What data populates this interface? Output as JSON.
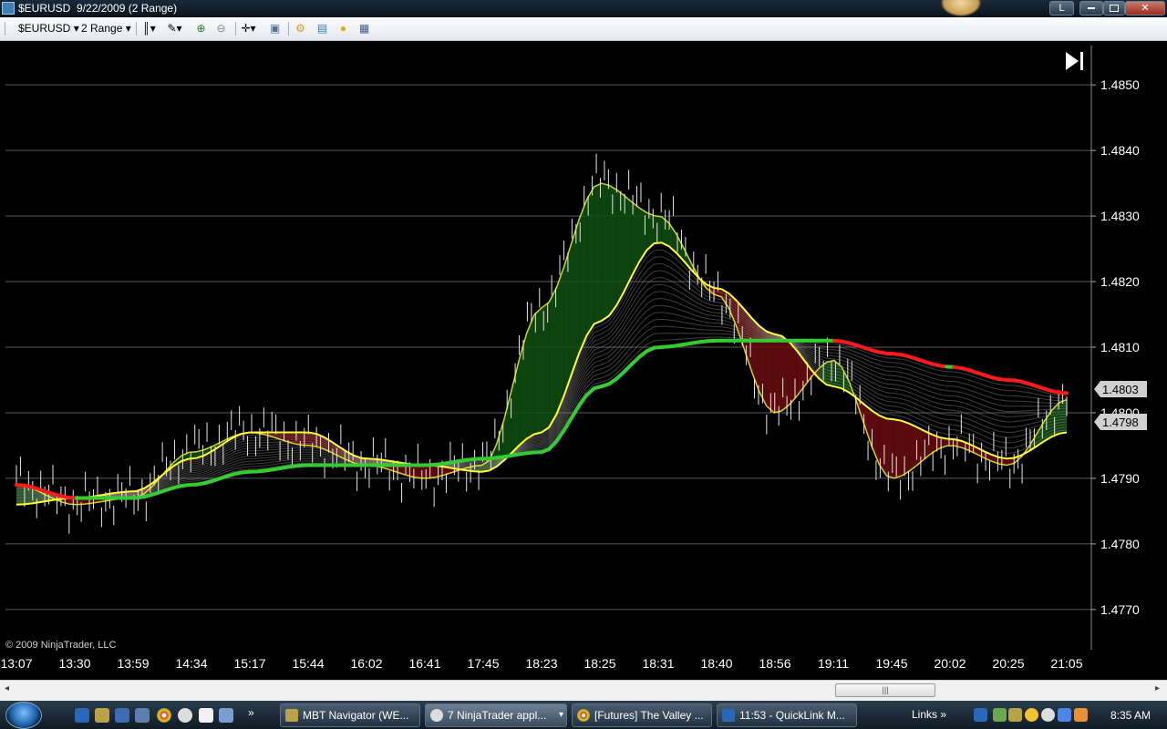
{
  "window": {
    "title": "$EURUSD  9/22/2009 (2 Range)",
    "buttons": [
      "L",
      "",
      "",
      "✕"
    ]
  },
  "toolbar": {
    "instrument": "$EURUSD",
    "period": "2 Range",
    "icons": [
      "bar-type-icon",
      "drawing-tools-icon",
      "zoom-in-icon",
      "zoom-out-icon",
      "crosshair-icon",
      "data-box-icon",
      "strategies-icon",
      "indicators-icon",
      "properties-icon",
      "chart-trader-icon"
    ]
  },
  "chart": {
    "copyright": "© 2009 NinjaTrader, LLC",
    "price_labels": [
      "1.4850",
      "1.4840",
      "1.4830",
      "1.4820",
      "1.4810",
      "1.4800",
      "1.4790",
      "1.4780",
      "1.4770"
    ],
    "last_price_red": "1.4803",
    "last_price_yellow": "1.4798",
    "time_labels": [
      "13:07",
      "13:30",
      "13:59",
      "14:34",
      "15:17",
      "15:44",
      "16:02",
      "16:41",
      "17:45",
      "18:23",
      "18:25",
      "18:31",
      "18:40",
      "18:56",
      "19:11",
      "19:45",
      "20:02",
      "20:25",
      "21:05"
    ],
    "colors": {
      "bg": "#000000",
      "fast": "#ffff33",
      "slow": "#33cc33",
      "bear": "#ff1a1a",
      "bull_fill": "#0f4f0f",
      "bear_fill": "#6b0d0d",
      "grid": "#5a5a5a"
    }
  },
  "chart_data": {
    "type": "line",
    "title": "",
    "x": [
      "13:07",
      "13:30",
      "13:59",
      "14:34",
      "15:17",
      "15:44",
      "16:02",
      "16:41",
      "17:45",
      "18:23",
      "18:25",
      "18:31",
      "18:40",
      "18:56",
      "19:11",
      "19:45",
      "20:02",
      "20:25",
      "21:05"
    ],
    "ylim": [
      1.4764,
      1.4856
    ],
    "grid": true,
    "series": [
      {
        "values": [
          1.4789,
          1.4786,
          1.4787,
          1.4794,
          1.4797,
          1.4795,
          1.4792,
          1.479,
          1.4792,
          1.4816,
          1.4835,
          1.483,
          1.4818,
          1.48,
          1.4808,
          1.479,
          1.4795,
          1.4792,
          1.4802
        ]
      },
      {
        "values": [
          1.4786,
          1.4787,
          1.4788,
          1.4793,
          1.4797,
          1.4797,
          1.4793,
          1.4792,
          1.4791,
          1.4797,
          1.4814,
          1.4826,
          1.4819,
          1.4812,
          1.4804,
          1.4799,
          1.4796,
          1.4793,
          1.4797
        ]
      },
      {
        "values": [
          1.4789,
          1.4787,
          1.4787,
          1.4789,
          1.4791,
          1.4792,
          1.4792,
          1.4792,
          1.4793,
          1.4794,
          1.4804,
          1.481,
          1.4811,
          1.4811,
          1.4811,
          1.4809,
          1.4807,
          1.4805,
          1.4803
        ]
      }
    ]
  },
  "scrollbar": {
    "left_arrow": "◂",
    "right_arrow": "▸",
    "thumb_grip": "|||"
  },
  "taskbar": {
    "tasks": [
      {
        "label": "MBT Navigator (WE..."
      },
      {
        "label": "7 NinjaTrader appl..."
      },
      {
        "label": "[Futures] The Valley ..."
      },
      {
        "label": "11:53 - QuickLink M..."
      }
    ],
    "chevron": "»",
    "links_label": "Links",
    "links_chevron": "»",
    "clock": "8:35 AM"
  }
}
